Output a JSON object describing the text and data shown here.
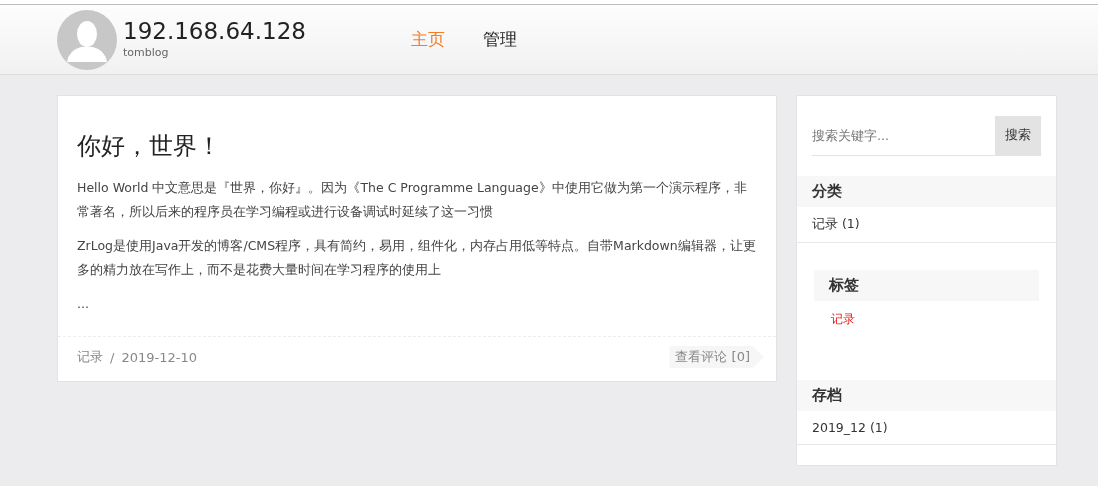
{
  "header": {
    "site_title": "192.168.64.128",
    "subtitle": "tomblog",
    "nav": [
      {
        "label": "主页",
        "selected": true
      },
      {
        "label": "管理",
        "selected": false
      }
    ]
  },
  "post": {
    "title": "你好，世界！",
    "paragraphs": [
      "Hello World 中文意思是『世界，你好』。因为《The C Programme Language》中使用它做为第一个演示程序，非常著名，所以后来的程序员在学习编程或进行设备调试时延续了这一习惯",
      "ZrLog是使用Java开发的博客/CMS程序，具有简约，易用，组件化，内存占用低等特点。自带Markdown编辑器，让更多的精力放在写作上，而不是花费大量时间在学习程序的使用上",
      "..."
    ],
    "category": "记录",
    "separator": "/",
    "date": "2019-12-10",
    "comments_link": "查看评论 [0]"
  },
  "sidebar": {
    "search": {
      "placeholder": "搜索关键字...",
      "button": "搜索"
    },
    "sections": [
      {
        "kind": "list",
        "title": "分类",
        "items": [
          "记录 (1)"
        ]
      },
      {
        "kind": "tags",
        "title": "标签",
        "items": [
          "记录"
        ]
      },
      {
        "kind": "list",
        "title": "存档",
        "items": [
          "2019_12 (1)"
        ]
      }
    ]
  }
}
